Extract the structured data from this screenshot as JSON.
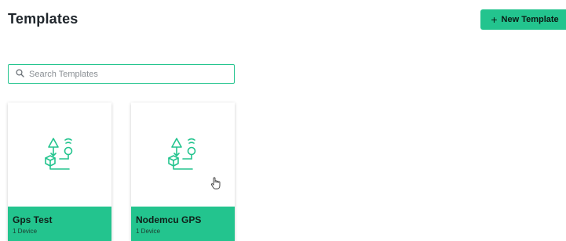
{
  "header": {
    "title": "Templates",
    "new_button_icon": "plus-icon",
    "new_button_label": "New Template"
  },
  "search": {
    "icon": "search-icon",
    "placeholder": "Search Templates",
    "value": ""
  },
  "templates": [
    {
      "icon": "device-flow-icon",
      "name": "Gps Test",
      "device_count": "1 Device"
    },
    {
      "icon": "device-flow-icon",
      "name": "Nodemcu GPS",
      "device_count": "1 Device"
    }
  ],
  "colors": {
    "accent": "#23c48e",
    "title": "#20262c",
    "card_background": "#ffffff"
  }
}
